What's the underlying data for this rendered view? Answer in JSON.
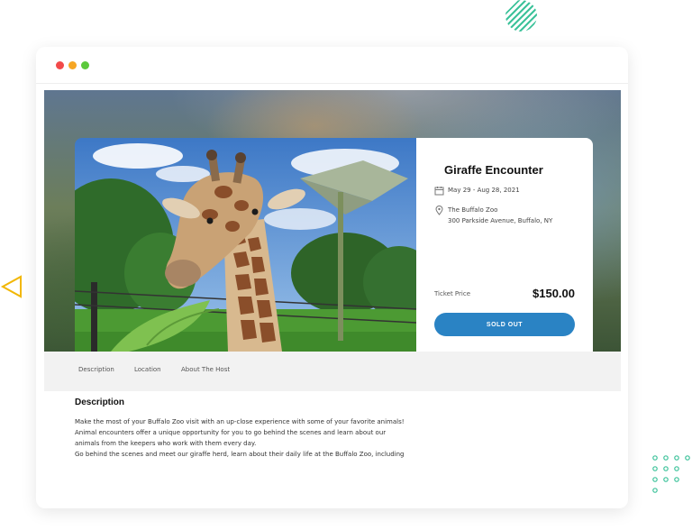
{
  "event": {
    "title": "Giraffe Encounter",
    "dates": "May 29 - Aug 28, 2021",
    "venue": "The Buffalo Zoo",
    "address": "300 Parkside Avenue, Buffalo, NY",
    "price_label": "Ticket Price",
    "price": "$150.00",
    "button_label": "SOLD OUT"
  },
  "tabs": [
    {
      "label": "Description"
    },
    {
      "label": "Location"
    },
    {
      "label": "About The Host"
    }
  ],
  "description": {
    "heading": "Description",
    "lines": [
      "Make the most of your Buffalo Zoo visit with an up-close experience with some of your favorite animals!",
      "Animal encounters offer a unique opportunity for you to go behind the scenes and learn about our",
      "animals from the keepers who work with them every day.",
      "Go behind the scenes and meet our giraffe herd, learn about their daily life at the Buffalo Zoo, including"
    ]
  },
  "colors": {
    "accent": "#2a83c4",
    "deco_green": "#3cc29a",
    "deco_yellow": "#f2b705",
    "dot_red": "#f24a4a",
    "dot_yellow": "#f6a623",
    "dot_green": "#5cc93b"
  },
  "icons": [
    "calendar-icon",
    "location-pin-icon"
  ]
}
